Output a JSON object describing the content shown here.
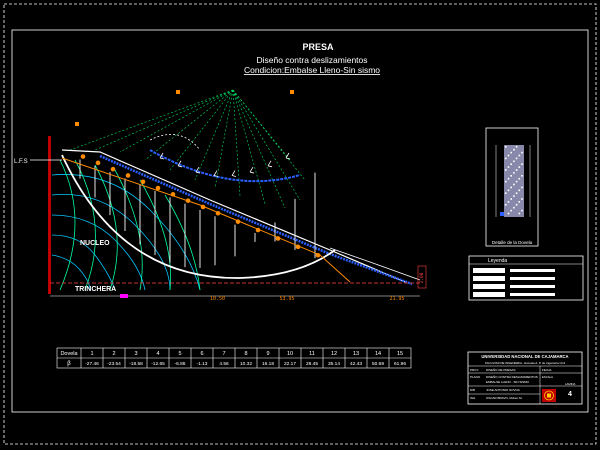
{
  "drawing": {
    "title": "PRESA",
    "subtitle": "Diseño contra deslizamientos",
    "condition": "Condicion:Embalse Lleno-Sin sismo",
    "water_level_label": "L.F.S",
    "zone_core": "NUCLEO",
    "zone_trench": "TRINCHERA",
    "dim_left": "10.50",
    "dim_mid": "53.95",
    "dim_right": "21.95",
    "side_tag": "2.00"
  },
  "detail": {
    "caption": "Detalle de la Dovela"
  },
  "legend": {
    "title": "Leyenda",
    "items": [
      "",
      "",
      "",
      ""
    ]
  },
  "table": {
    "header_label": "Dovela",
    "row_label": "β",
    "numbers": [
      "1",
      "2",
      "3",
      "4",
      "5",
      "6",
      "7",
      "8",
      "9",
      "10",
      "11",
      "12",
      "13",
      "14",
      "15"
    ],
    "betas": [
      "-27.46",
      "-23.54",
      "-18.58",
      "-12.65",
      "-6.86",
      "-1.13",
      "4.56",
      "10.32",
      "16.18",
      "22.17",
      "28.45",
      "35.14",
      "42.43",
      "50.69",
      "61.96"
    ]
  },
  "title_block": {
    "university": "UNIVERSIDAD NACIONAL DE CAJAMARCA",
    "faculty": "FACULTAD DE INGENIERIA - Escuela A. P. de Ingenieria Civil",
    "project_label": "PROY.",
    "project": "DISEÑO DE PRESAS",
    "plan_label": "PLANO",
    "plan_line1": "DISEÑO CONTRA DESLIZAMIENTOS",
    "plan_line2": "EMBALSE LLENO - SIN SISMO",
    "author_label": "DIB",
    "author": "JOSE ANTONIO NOVOA",
    "reviewer_label": "ING",
    "reviewer": "OSCAR BRAVO, Ruben M.",
    "date_label": "FECHA",
    "scale_label": "ESCALA",
    "sheet_label": "LAMINA",
    "sheet_no": "4"
  }
}
